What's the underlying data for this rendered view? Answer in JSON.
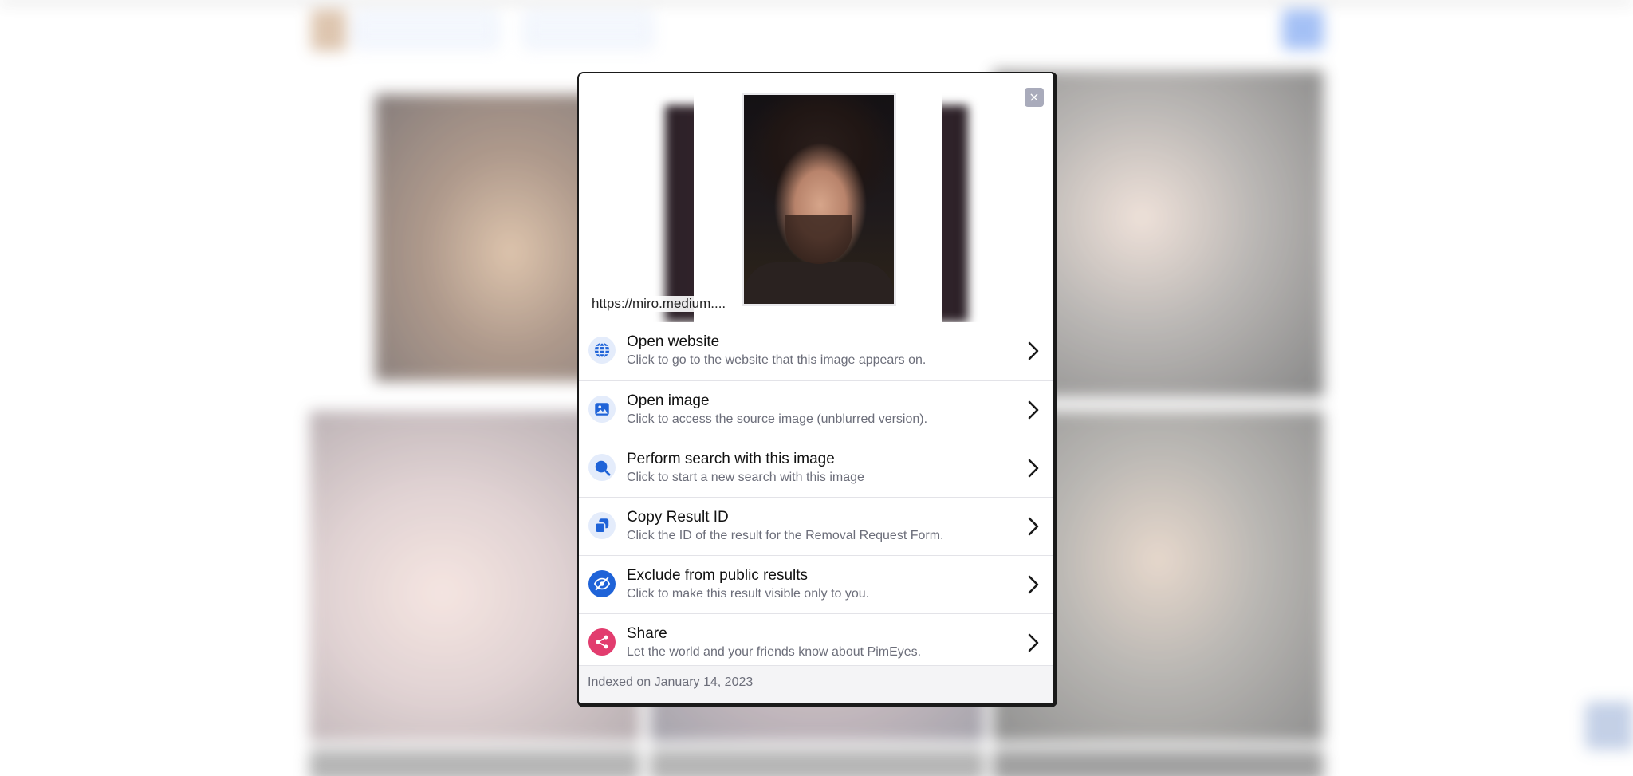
{
  "modal": {
    "close_label": "×",
    "preview": {
      "url": "https://miro.medium...."
    },
    "actions": [
      {
        "title": "Open website",
        "description": "Click to go to the website that this image appears on.",
        "icon": "globe-icon"
      },
      {
        "title": "Open image",
        "description": "Click to access the source image (unblurred version).",
        "icon": "image-icon"
      },
      {
        "title": "Perform search with this image",
        "description": "Click to start a new search with this image",
        "icon": "search-icon"
      },
      {
        "title": "Copy Result ID",
        "description": "Click the ID of the result for the Removal Request Form.",
        "icon": "copy-icon"
      },
      {
        "title": "Exclude from public results",
        "description": "Click to make this result visible only to you.",
        "icon": "eye-off-icon"
      },
      {
        "title": "Share",
        "description": "Let the world and your friends know about PimEyes.",
        "icon": "share-icon"
      }
    ],
    "footer": "Indexed on January 14, 2023"
  },
  "colors": {
    "accent_blue": "#1f63d8",
    "soft_icon_bg": "#e4ecfb",
    "share_pink": "#e23c6e",
    "close_bg": "#a9abbb"
  }
}
